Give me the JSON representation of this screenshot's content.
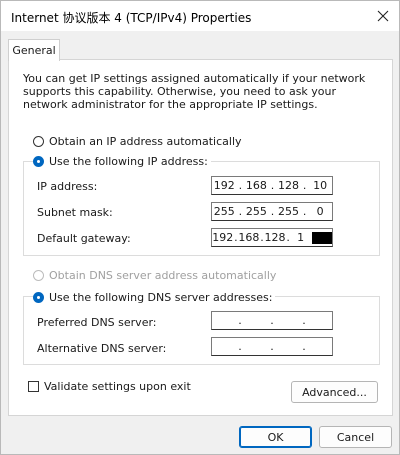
{
  "window": {
    "title": "Internet 协议版本 4 (TCP/IPv4) Properties"
  },
  "tabs": [
    {
      "label": "General"
    }
  ],
  "intro_text": "You can get IP settings assigned automatically if your network supports this capability. Otherwise, you need to ask your network administrator for the appropriate IP settings.",
  "ip": {
    "auto_label": "Obtain an IP address automatically",
    "manual_label": "Use the following IP address:",
    "auto_selected": false,
    "fields": [
      {
        "label": "IP address:",
        "octets": [
          "192",
          "168",
          "128",
          "10"
        ]
      },
      {
        "label": "Subnet mask:",
        "octets": [
          "255",
          "255",
          "255",
          "0"
        ]
      },
      {
        "label": "Default gateway:",
        "octets": [
          "192",
          "168",
          "128",
          "1"
        ]
      }
    ]
  },
  "dns": {
    "auto_label": "Obtain DNS server address automatically",
    "manual_label": "Use the following DNS server addresses:",
    "fields": [
      {
        "label": "Preferred DNS server:",
        "octets": [
          "",
          "",
          "",
          ""
        ]
      },
      {
        "label": "Alternative DNS server:",
        "octets": [
          "",
          "",
          "",
          ""
        ]
      }
    ]
  },
  "validate_label": "Validate settings upon exit",
  "validate_checked": false,
  "buttons": {
    "advanced": "Advanced...",
    "ok": "OK",
    "cancel": "Cancel"
  },
  "icons": {
    "close": "close-icon"
  }
}
